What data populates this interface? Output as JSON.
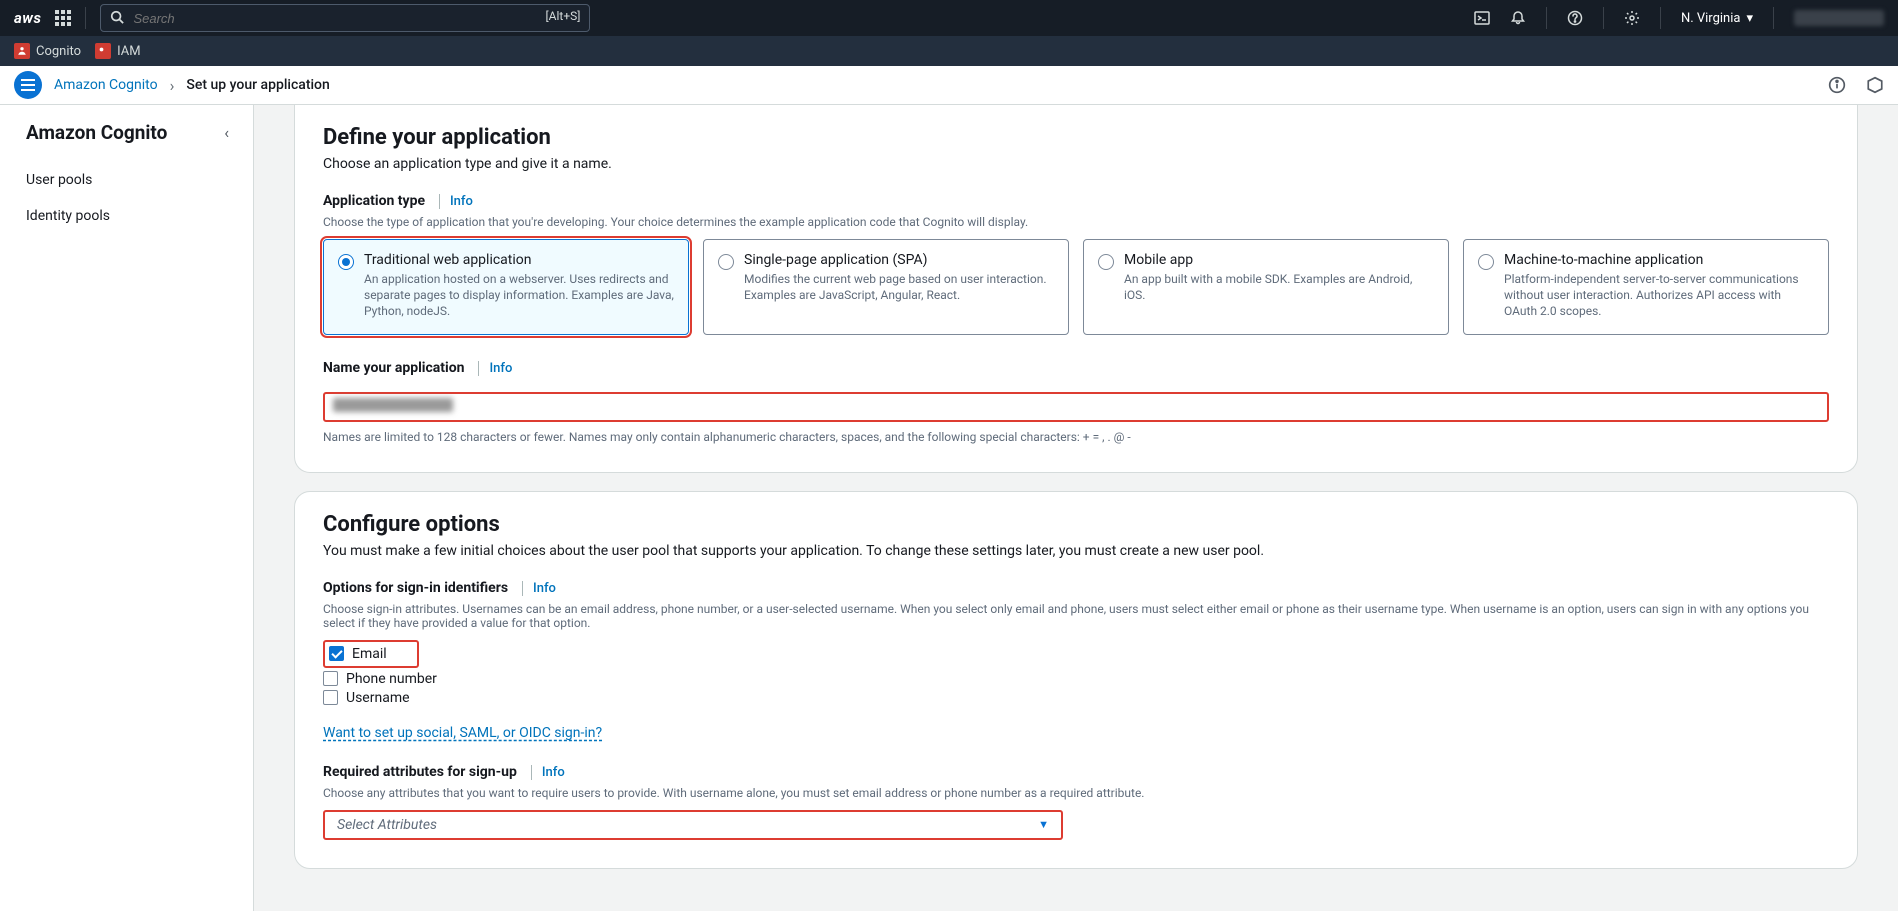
{
  "topnav": {
    "search_placeholder": "Search",
    "search_shortcut": "[Alt+S]",
    "region": "N. Virginia"
  },
  "favorites": [
    {
      "label": "Cognito"
    },
    {
      "label": "IAM"
    }
  ],
  "breadcrumb": {
    "service_link": "Amazon Cognito",
    "current": "Set up your application"
  },
  "sidebar": {
    "title": "Amazon Cognito",
    "items": [
      "User pools",
      "Identity pools"
    ]
  },
  "define": {
    "heading": "Define your application",
    "sub": "Choose an application type and give it a name.",
    "app_type_label": "Application type",
    "app_type_help": "Choose the type of application that you're developing. Your choice determines the example application code that Cognito will display.",
    "info": "Info",
    "radios": [
      {
        "title": "Traditional web application",
        "desc": "An application hosted on a webserver. Uses redirects and separate pages to display information. Examples are Java, Python, nodeJS.",
        "selected": true
      },
      {
        "title": "Single-page application (SPA)",
        "desc": "Modifies the current web page based on user interaction. Examples are JavaScript, Angular, React.",
        "selected": false
      },
      {
        "title": "Mobile app",
        "desc": "An app built with a mobile SDK. Examples are Android, iOS.",
        "selected": false
      },
      {
        "title": "Machine-to-machine application",
        "desc": "Platform-independent server-to-server communications without user interaction. Authorizes API access with OAuth 2.0 scopes.",
        "selected": false
      }
    ],
    "name_label": "Name your application",
    "name_constraint": "Names are limited to 128 characters or fewer. Names may only contain alphanumeric characters, spaces, and the following special characters: + = , . @ -"
  },
  "configure": {
    "heading": "Configure options",
    "sub": "You must make a few initial choices about the user pool that supports your application. To change these settings later, you must create a new user pool.",
    "signin_label": "Options for sign-in identifiers",
    "signin_help": "Choose sign-in attributes. Usernames can be an email address, phone number, or a user-selected username. When you select only email and phone, users must select either email or phone as their username type. When username is an option, users can sign in with any options you select if they have provided a value for that option.",
    "checkboxes": [
      {
        "label": "Email",
        "checked": true
      },
      {
        "label": "Phone number",
        "checked": false
      },
      {
        "label": "Username",
        "checked": false
      }
    ],
    "social_link": "Want to set up social, SAML, or OIDC sign-in?",
    "req_attr_label": "Required attributes for sign-up",
    "req_attr_help": "Choose any attributes that you want to require users to provide. With username alone, you must set email address or phone number as a required attribute.",
    "select_placeholder": "Select Attributes",
    "info": "Info"
  }
}
